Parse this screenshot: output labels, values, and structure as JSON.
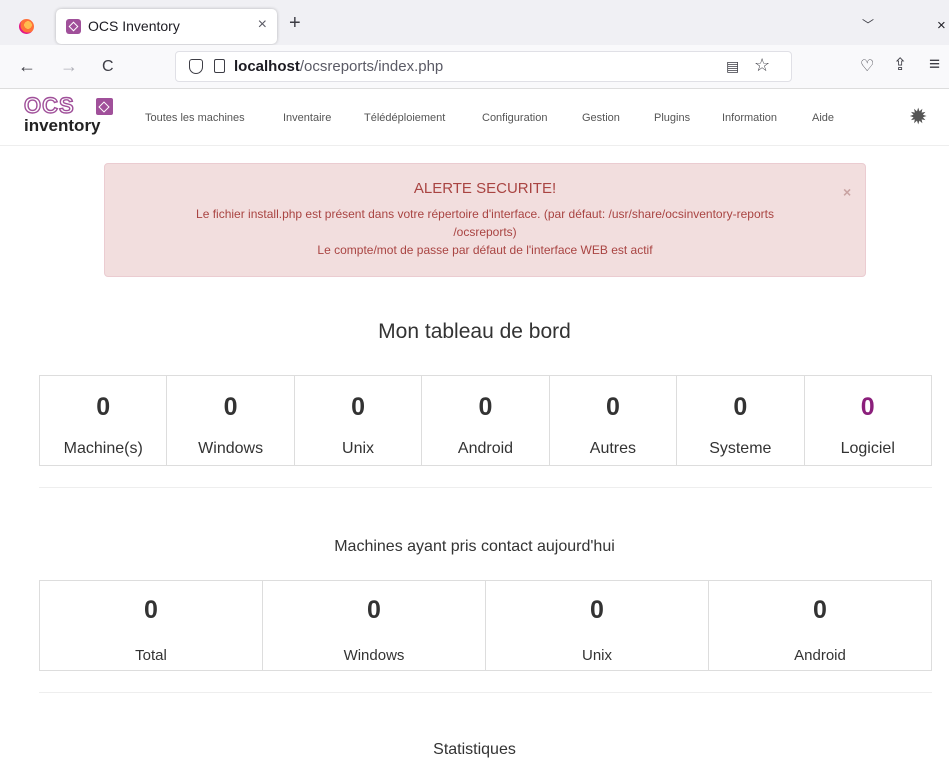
{
  "browser": {
    "tab_title": "OCS Inventory",
    "tab_close": "×",
    "new_tab": "+",
    "tab_list": "﹀",
    "window_close": "×",
    "back": "←",
    "forward": "→",
    "reload": "C",
    "url_host": "localhost",
    "url_path": "/ocsreports/index.php",
    "reader_icon": "▤",
    "bookmark_icon": "☆",
    "pocket_icon": "♡",
    "share_icon": "⇪",
    "menu_icon": "≡"
  },
  "app": {
    "logo_top": "OCS",
    "logo_bottom": "inventory",
    "brand_color": "#a0509a",
    "menu": [
      "Toutes les machines",
      "Inventaire",
      "Télédéploiement",
      "Configuration",
      "Gestion",
      "Plugins",
      "Information",
      "Aide"
    ],
    "settings_icon": "gear-icon",
    "settings_glyph": "✹"
  },
  "alert": {
    "title": "ALERTE SECURITE!",
    "line1": "Le fichier install.php est présent dans votre répertoire d'interface. (par défaut: /usr/share/ocsinventory-reports",
    "line2": "/ocsreports)",
    "line3": "Le compte/mot de passe par défaut de l'interface WEB est actif",
    "close": "×"
  },
  "dashboard": {
    "title": "Mon tableau de bord",
    "stats": [
      {
        "value": "0",
        "label": "Machine(s)"
      },
      {
        "value": "0",
        "label": "Windows"
      },
      {
        "value": "0",
        "label": "Unix"
      },
      {
        "value": "0",
        "label": "Android"
      },
      {
        "value": "0",
        "label": "Autres"
      },
      {
        "value": "0",
        "label": "Systeme"
      },
      {
        "value": "0",
        "label": "Logiciel"
      }
    ],
    "highlight_color": "#8b1f7b"
  },
  "contact": {
    "title": "Machines ayant pris contact aujourd'hui",
    "stats": [
      {
        "value": "0",
        "label": "Total"
      },
      {
        "value": "0",
        "label": "Windows"
      },
      {
        "value": "0",
        "label": "Unix"
      },
      {
        "value": "0",
        "label": "Android"
      }
    ]
  },
  "statistics": {
    "title": "Statistiques"
  }
}
